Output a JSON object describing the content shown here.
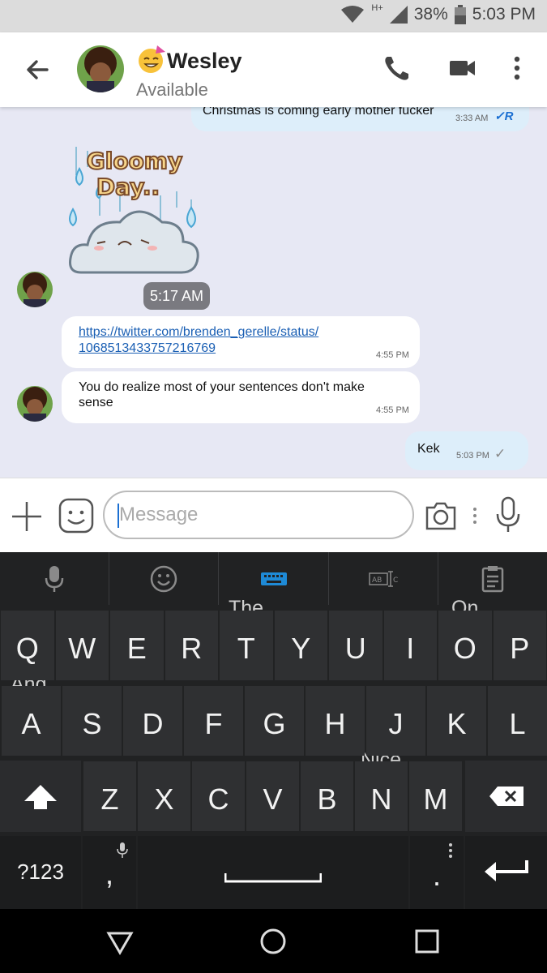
{
  "status_bar": {
    "battery": "38%",
    "time": "5:03 PM",
    "network": "H+"
  },
  "header": {
    "contact_name": "Wesley",
    "presence": "Available"
  },
  "chat": {
    "top_message": {
      "text": "Christmas is coming early mother fucker",
      "time": "3:33 AM",
      "receipt": "R"
    },
    "sticker": {
      "line1": "Gloomy",
      "line2": "Day..",
      "time": "5:17 AM"
    },
    "link_message": {
      "line1": "https://twitter.com/brenden_gerelle/status/",
      "line2": "1068513433757216769",
      "time": "4:55 PM"
    },
    "text_message": {
      "line1": "You do realize most of your sentences don't make",
      "line2": "sense",
      "time": "4:55 PM"
    },
    "outgoing_message": {
      "text": "Kek",
      "time": "5:03 PM"
    }
  },
  "composer": {
    "placeholder": "Message"
  },
  "keyboard": {
    "suggestions": {
      "the": "The",
      "on": "On",
      "and": "And",
      "nice": "Nice"
    },
    "row1": [
      "Q",
      "W",
      "E",
      "R",
      "T",
      "Y",
      "U",
      "I",
      "O",
      "P"
    ],
    "row2": [
      "A",
      "S",
      "D",
      "F",
      "G",
      "H",
      "J",
      "K",
      "L"
    ],
    "row3": [
      "Z",
      "X",
      "C",
      "V",
      "B",
      "N",
      "M"
    ],
    "symbols_key": "?123",
    "comma": ",",
    "period": "."
  },
  "colors": {
    "accent": "#1b6fd2",
    "chat_bg": "#e7e8f4",
    "outgoing_bubble": "#ddeefa",
    "keyboard_bg": "#212223"
  }
}
